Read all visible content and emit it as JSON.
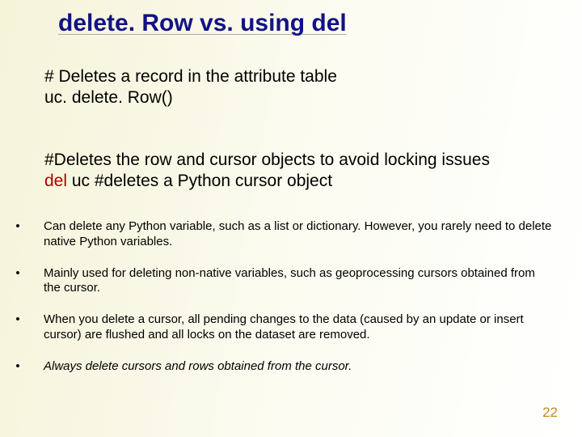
{
  "title": "delete. Row vs. using del",
  "code_block_1": {
    "comment": "# Deletes a record in the attribute table",
    "code": "uc. delete. Row()"
  },
  "code_block_2": {
    "comment": "#Deletes the row and cursor objects to avoid locking issues",
    "keyword": "del",
    "rest": " uc  #deletes a Python cursor object"
  },
  "bullets": [
    "Can delete any Python variable, such as a list or dictionary. However, you rarely need to delete native Python variables.",
    "Mainly used for deleting non-native variables, such as geoprocessing cursors obtained from the cursor.",
    "When you delete a cursor, all pending changes to the data (caused by an update or insert cursor) are flushed and all locks on the dataset are removed.",
    "Always delete cursors and rows obtained from the cursor."
  ],
  "page_number": "22"
}
